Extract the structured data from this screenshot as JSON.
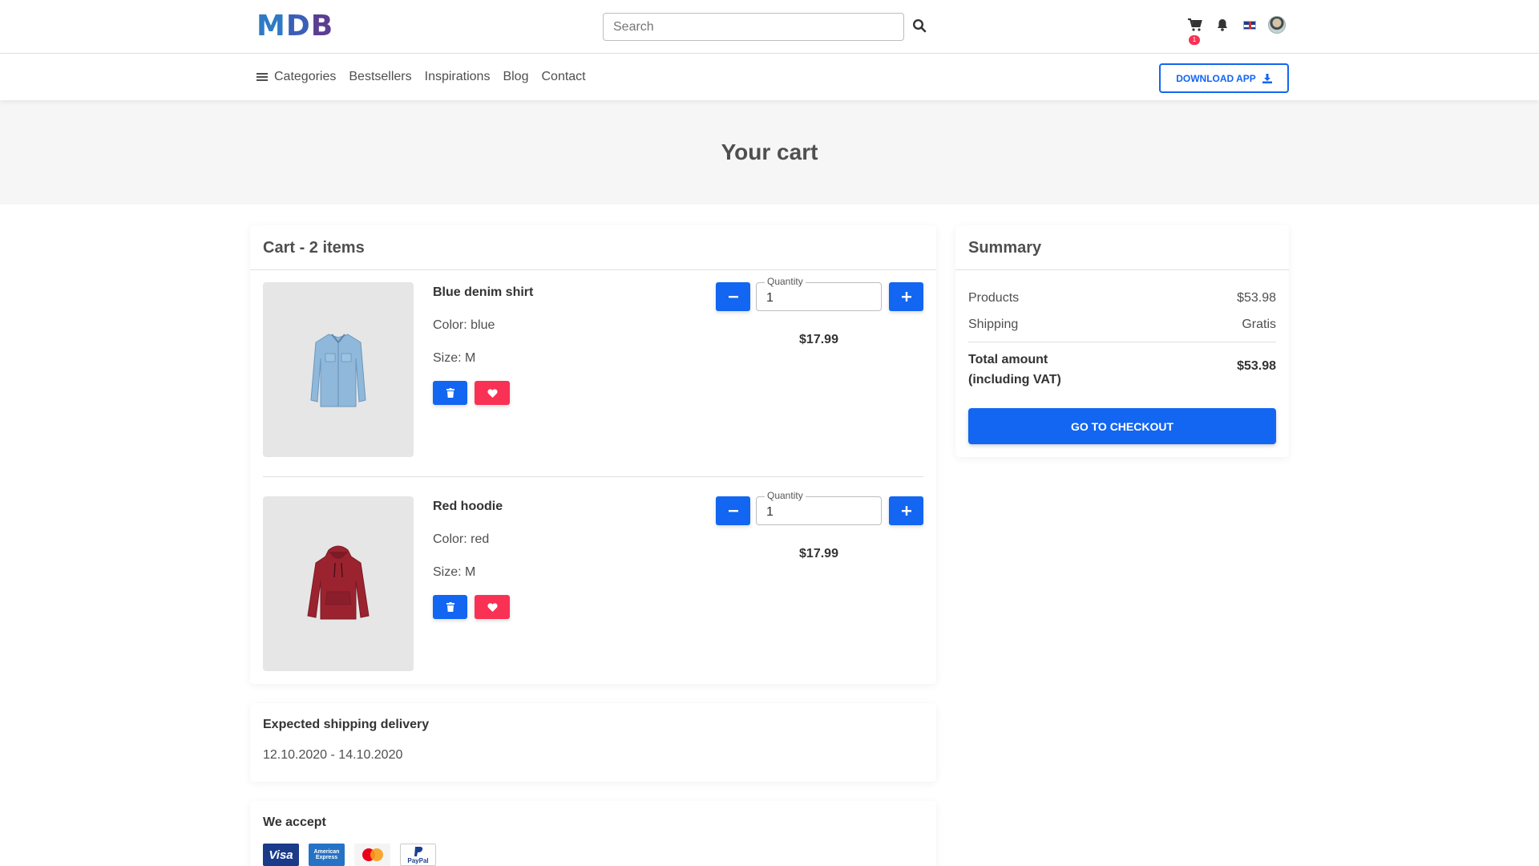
{
  "brand": {
    "logo_text": "MDB"
  },
  "search": {
    "placeholder": "Search"
  },
  "top_icons": [
    "cart-icon",
    "bell-icon",
    "flag-uk-icon",
    "avatar"
  ],
  "cart_badge_count": "1",
  "nav": {
    "categories": "Categories",
    "links": [
      "Bestsellers",
      "Inspirations",
      "Blog",
      "Contact"
    ],
    "download_label": "Download app"
  },
  "hero": {
    "title": "Your cart"
  },
  "cart": {
    "header": "Cart - 2 items",
    "items": [
      {
        "name": "Blue denim shirt",
        "color": "Color: blue",
        "size": "Size: M",
        "quantity_label": "Quantity",
        "quantity": "1",
        "price": "$17.99",
        "image_icon": "shirt-icon"
      },
      {
        "name": "Red hoodie",
        "color": "Color: red",
        "size": "Size: M",
        "quantity_label": "Quantity",
        "quantity": "1",
        "price": "$17.99",
        "image_icon": "hoodie-icon"
      }
    ]
  },
  "summary": {
    "header": "Summary",
    "products_label": "Products",
    "products_value": "$53.98",
    "shipping_label": "Shipping",
    "shipping_value": "Gratis",
    "total_label": "Total amount (including VAT)",
    "total_value": "$53.98",
    "checkout_label": "Go to checkout"
  },
  "shipping": {
    "title": "Expected shipping delivery",
    "dates": "12.10.2020 - 14.10.2020"
  },
  "payment": {
    "title": "We accept",
    "methods": [
      "Visa",
      "American Express",
      "Mastercard",
      "PayPal"
    ]
  },
  "colors": {
    "primary": "#1266f1",
    "danger": "#f93154",
    "text": "#4f4f4f",
    "hero_bg": "#f6f6f6"
  }
}
